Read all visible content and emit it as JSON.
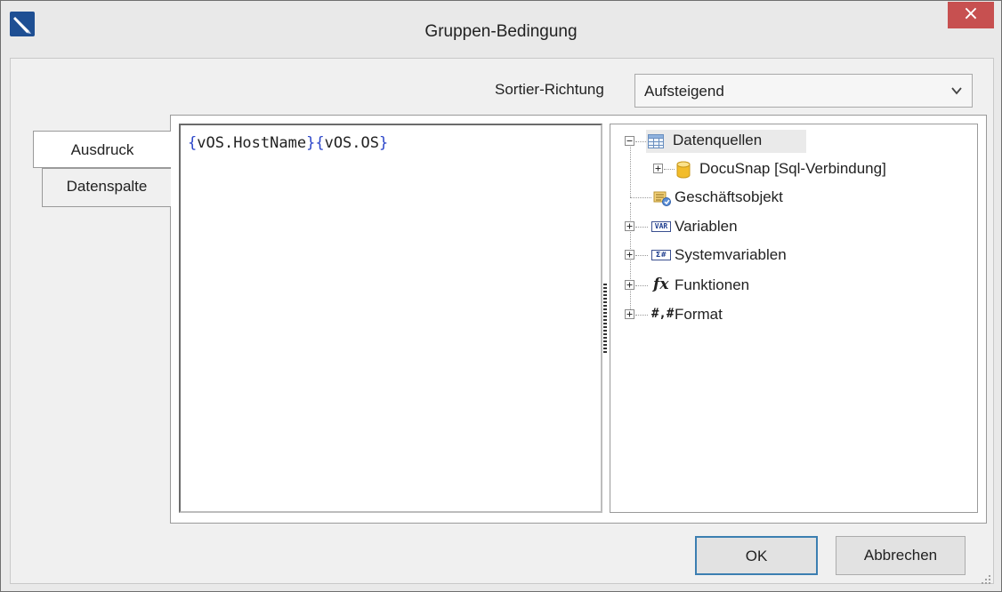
{
  "window": {
    "title": "Gruppen-Bedingung",
    "close_glyph": "×"
  },
  "sort": {
    "label": "Sortier-Richtung",
    "value": "Aufsteigend"
  },
  "tabs": [
    {
      "label": "Ausdruck"
    },
    {
      "label": "Datenspalte"
    }
  ],
  "expression": {
    "parts": [
      "{",
      "vOS.HostName",
      "}",
      "{",
      "vOS.OS",
      "}"
    ]
  },
  "tree": {
    "items": [
      {
        "label": "Datenquellen",
        "icon": "datasource-table-icon"
      },
      {
        "label": "DocuSnap [Sql-Verbindung]",
        "icon": "database-cylinder-icon"
      },
      {
        "label": "Geschäftsobjekt",
        "icon": "business-object-icon"
      },
      {
        "label": "Variablen",
        "icon": "var-icon",
        "icon_text": "VAR"
      },
      {
        "label": "Systemvariablen",
        "icon": "system-variable-icon",
        "icon_text": "Σ#"
      },
      {
        "label": "Funktionen",
        "icon": "function-fx-icon",
        "icon_text": "fx"
      },
      {
        "label": "Format",
        "icon": "format-icon",
        "icon_text": "#,#"
      }
    ]
  },
  "buttons": {
    "ok": "OK",
    "cancel": "Abbrechen"
  },
  "colors": {
    "accent": "#3c7fb1",
    "close": "#c75050",
    "brace": "#2b45c9",
    "app_icon": "#1e4f93"
  }
}
